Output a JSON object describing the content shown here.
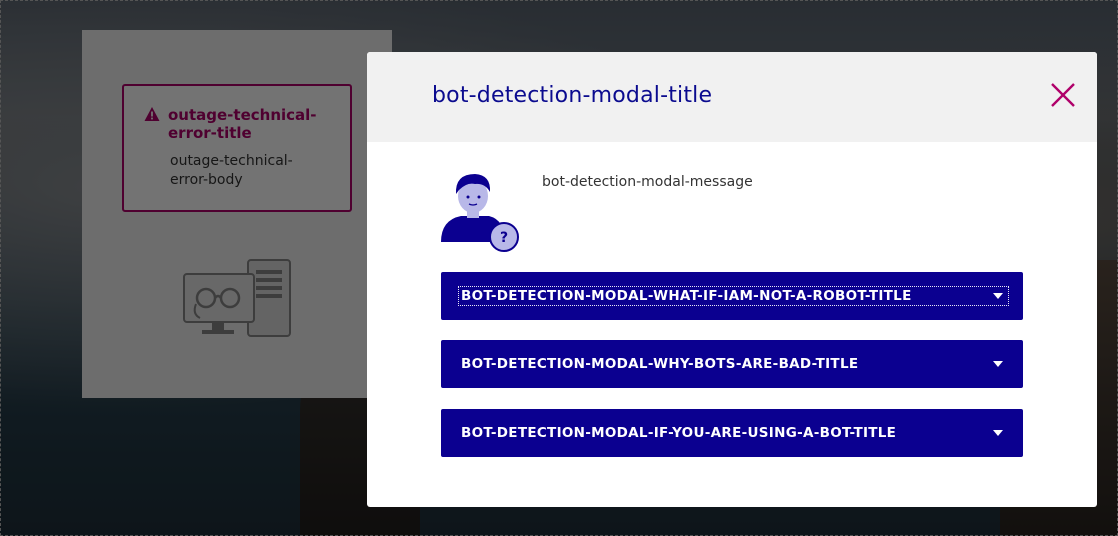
{
  "outage": {
    "title": "outage-technical-error-title",
    "body": "outage-technical-error-body",
    "accent_color": "#b0006a",
    "warning_icon": "warning-triangle-icon",
    "illustration_icon": "computer-error-icon"
  },
  "modal": {
    "title": "bot-detection-modal-title",
    "message": "bot-detection-modal-message",
    "close_icon": "close-icon",
    "avatar_icon": "user-question-icon",
    "title_color": "#0b0b8f",
    "accordion_color": "#0b0090",
    "accordions": [
      {
        "label": "BOT-DETECTION-MODAL-WHAT-IF-IAM-NOT-A-ROBOT-TITLE",
        "expanded": false,
        "focused": true
      },
      {
        "label": "BOT-DETECTION-MODAL-WHY-BOTS-ARE-BAD-TITLE",
        "expanded": false,
        "focused": false
      },
      {
        "label": "BOT-DETECTION-MODAL-IF-YOU-ARE-USING-A-BOT-TITLE",
        "expanded": false,
        "focused": false
      }
    ]
  }
}
